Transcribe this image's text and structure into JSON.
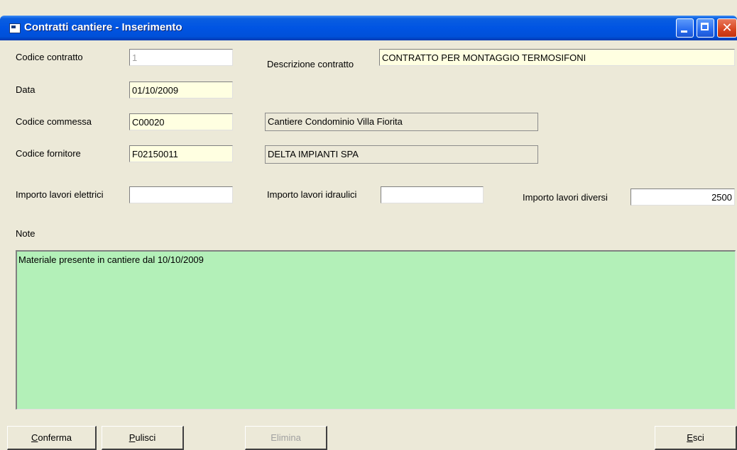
{
  "window": {
    "title": "Contratti cantiere - Inserimento"
  },
  "form": {
    "codice_contratto": {
      "label": "Codice contratto",
      "value": "1"
    },
    "descrizione_contratto": {
      "label": "Descrizione contratto",
      "value": "CONTRATTO PER MONTAGGIO TERMOSIFONI"
    },
    "data": {
      "label": "Data",
      "value": "01/10/2009"
    },
    "codice_commessa": {
      "label": "Codice commessa",
      "value": "C00020",
      "description": "Cantiere Condominio Villa Fiorita"
    },
    "codice_fornitore": {
      "label": "Codice fornitore",
      "value": "F02150011",
      "description": "DELTA IMPIANTI SPA"
    },
    "importo_elettrici": {
      "label": "Importo lavori elettrici",
      "value": ""
    },
    "importo_idraulici": {
      "label": "Importo lavori idraulici",
      "value": ""
    },
    "importo_diversi": {
      "label": "Importo lavori diversi",
      "value": "2500"
    },
    "note": {
      "label": "Note",
      "value": "Materiale presente in cantiere dal 10/10/2009"
    }
  },
  "buttons": {
    "conferma": {
      "mnemonic": "C",
      "rest": "onferma"
    },
    "pulisci": {
      "mnemonic": "P",
      "rest": "ulisci"
    },
    "elimina": {
      "mnemonic": "",
      "rest": "Elimina"
    },
    "esci": {
      "mnemonic": "E",
      "rest": "sci"
    }
  },
  "colors": {
    "titlebar": "#0054e3",
    "required_field": "#ffffe1",
    "notes_background": "#b3f0b8",
    "window_background": "#ece9d8"
  },
  "icons": [
    "window-icon",
    "minimize-icon",
    "maximize-icon",
    "close-icon"
  ]
}
